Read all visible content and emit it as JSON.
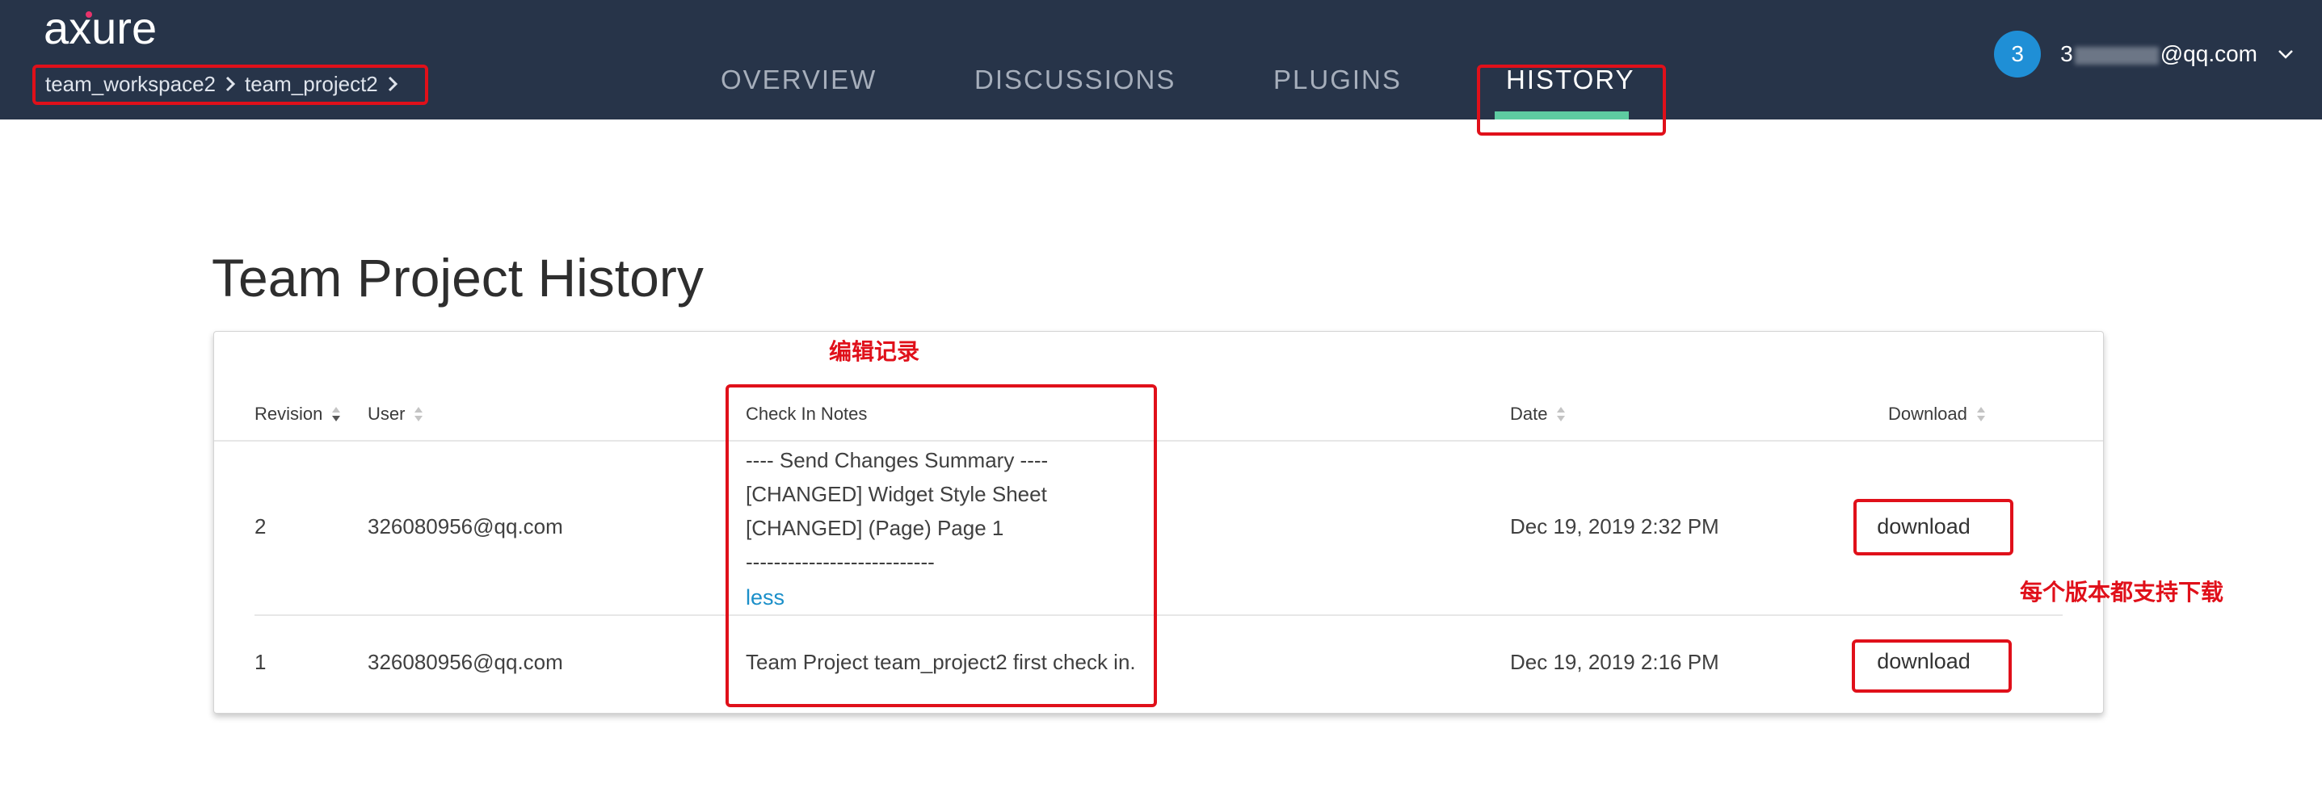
{
  "header": {
    "logo_text": "axure",
    "breadcrumb": [
      {
        "label": "team_workspace2"
      },
      {
        "label": "team_project2"
      }
    ],
    "tabs": [
      {
        "label": "OVERVIEW",
        "active": false
      },
      {
        "label": "DISCUSSIONS",
        "active": false
      },
      {
        "label": "PLUGINS",
        "active": false
      },
      {
        "label": "HISTORY",
        "active": true
      }
    ],
    "user": {
      "avatar_initial": "3",
      "email_prefix": "3",
      "email_suffix": "@qq.com"
    }
  },
  "page": {
    "title": "Team Project History"
  },
  "table": {
    "columns": {
      "revision": "Revision",
      "user": "User",
      "notes": "Check In Notes",
      "date": "Date",
      "download": "Download"
    },
    "rows": [
      {
        "revision": "2",
        "user": "326080956@qq.com",
        "notes": [
          "---- Send Changes Summary ----",
          "[CHANGED]  Widget Style Sheet",
          "[CHANGED]  (Page)     Page 1",
          "---------------------------"
        ],
        "notes_toggle": "less",
        "date": "Dec 19, 2019 2:32 PM",
        "download_label": "download"
      },
      {
        "revision": "1",
        "user": "326080956@qq.com",
        "notes": [
          "Team Project team_project2 first check in."
        ],
        "date": "Dec 19, 2019 2:16 PM",
        "download_label": "download"
      }
    ]
  },
  "annotations": {
    "edit_record": "编辑记录",
    "download_note": "每个版本都支持下载"
  },
  "colors": {
    "topbar": "#273449",
    "accent_underline": "#5ecba1",
    "avatar": "#1f8fd6",
    "link": "#1a8fc9",
    "annotation": "#e0101a"
  }
}
